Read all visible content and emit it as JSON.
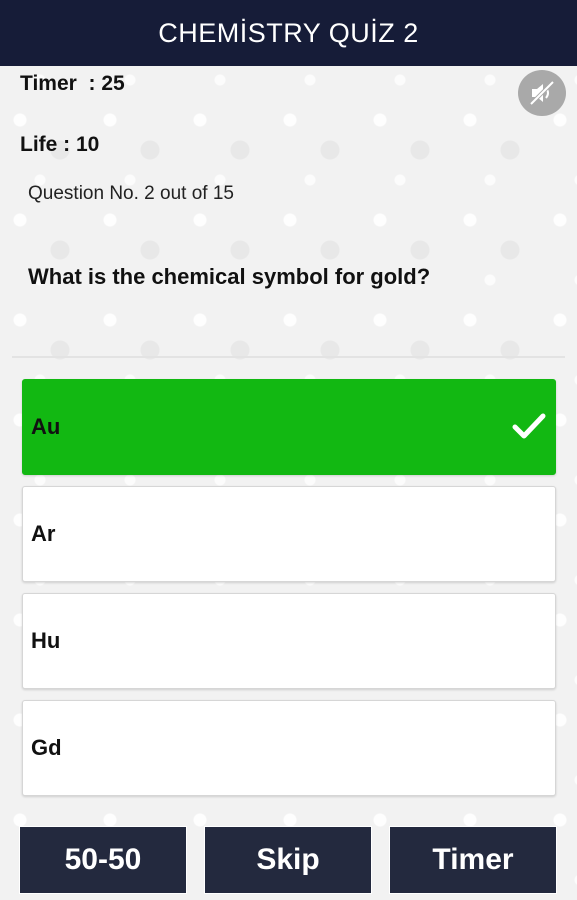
{
  "header": {
    "title": "CHEMİSTRY QUİZ 2"
  },
  "status": {
    "timer_label": "Timer  : ",
    "timer_value": "25",
    "life_label": "Life : ",
    "life_value": "10"
  },
  "sound_toggle": {
    "icon": "sound-off-icon",
    "color": "#a9a9a9"
  },
  "question": {
    "number_text": "Question No. 2 out of 15",
    "text": "What is the chemical symbol for gold?"
  },
  "options": [
    {
      "label": "Au",
      "state": "correct",
      "icon": "checkmark-icon"
    },
    {
      "label": "Ar",
      "state": "default"
    },
    {
      "label": "Hu",
      "state": "default"
    },
    {
      "label": "Gd",
      "state": "default"
    }
  ],
  "lifelines": [
    {
      "label": "50-50"
    },
    {
      "label": "Skip"
    },
    {
      "label": "Timer"
    }
  ],
  "colors": {
    "header_bg": "#161c38",
    "correct_green": "#12b812",
    "button_bg": "#23293e"
  }
}
